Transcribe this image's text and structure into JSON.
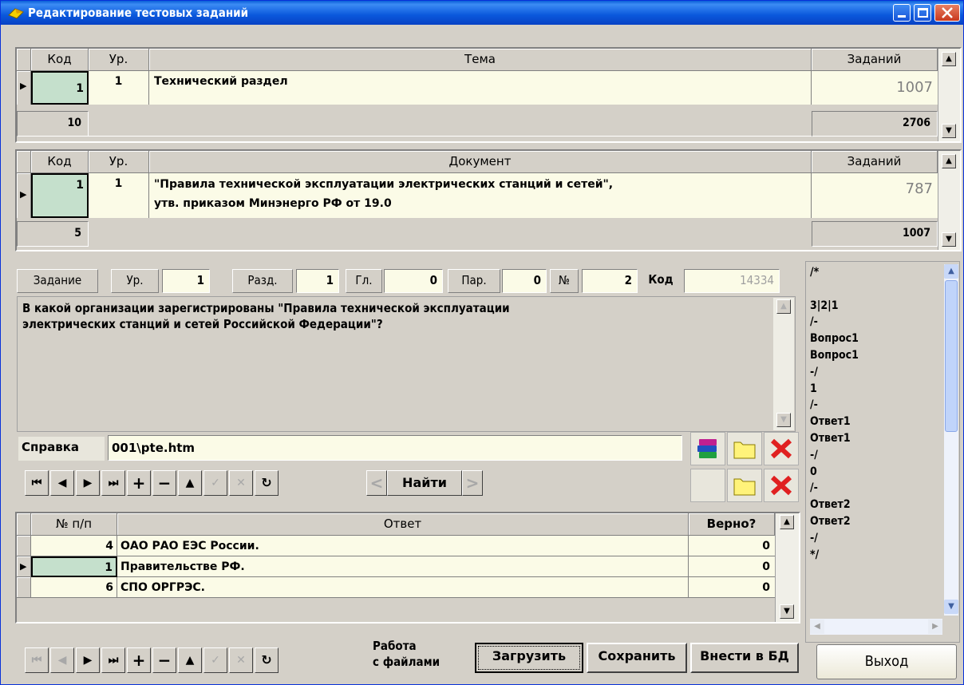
{
  "window": {
    "title": "Редактирование тестовых заданий"
  },
  "topics": {
    "headers": [
      "Код",
      "Ур.",
      "Тема",
      "Заданий"
    ],
    "row": {
      "code": "1",
      "level": "1",
      "topic": "Технический раздел",
      "count": "1007"
    },
    "footer": {
      "count": "10",
      "total": "2706"
    }
  },
  "documents": {
    "headers": [
      "Код",
      "Ур.",
      "Документ",
      "Заданий"
    ],
    "row": {
      "code": "1",
      "level": "1",
      "doc_line1": "\"Правила технической эксплуатации электрических станций и сетей\",",
      "doc_line2": "утв. приказом Минэнерго РФ от 19.0",
      "count": "787"
    },
    "footer": {
      "count": "5",
      "total": "1007"
    }
  },
  "task": {
    "label": "Задание",
    "level_label": "Ур.",
    "level": "1",
    "section_label": "Разд.",
    "section": "1",
    "chapter_label": "Гл.",
    "chapter": "0",
    "paragraph_label": "Пар.",
    "paragraph": "0",
    "number_label": "№",
    "number": "2",
    "code_label": "Код",
    "code": "14334",
    "question_line1": "В какой организации зарегистрированы \"Правила технической эксплуатации",
    "question_line2": "электрических станций и сетей Российской Федерации\"?",
    "help_label": "Справка",
    "help_value": "001\\pte.htm",
    "find_label": "Найти"
  },
  "answers": {
    "headers": [
      "№ п/п",
      "Ответ",
      "Верно?"
    ],
    "rows": [
      {
        "num": "4",
        "text": "ОАО РАО ЕЭС России.",
        "correct": "0"
      },
      {
        "num": "1",
        "text": "Правительстве РФ.",
        "correct": "0"
      },
      {
        "num": "6",
        "text": "СПО ОРГРЭС.",
        "correct": "0"
      }
    ]
  },
  "file_panel": {
    "lines": [
      "/*",
      "",
      "3|2|1",
      "/-",
      "Вопрос1",
      "Вопрос1",
      "-/",
      "1",
      "/-",
      "Ответ1",
      "Ответ1",
      "-/",
      "0",
      "/-",
      "Ответ2",
      "Ответ2",
      "-/",
      "*/"
    ]
  },
  "bottom": {
    "files_label_1": "Работа",
    "files_label_2": "с файлами",
    "load": "Загрузить",
    "save": "Сохранить",
    "db": "Внести в БД",
    "exit": "Выход"
  },
  "nav_symbols": {
    "first": "⏮",
    "prev": "◀",
    "next": "▶",
    "last": "⏭",
    "add": "+",
    "del": "−",
    "up": "▲",
    "ok": "✓",
    "cancel": "✕",
    "refresh": "↻",
    "lt": "<",
    "gt": ">"
  },
  "colors": {
    "title": "#0a5fd8",
    "selected": "#c5e0cc",
    "row": "#fbfbe7",
    "delete": "#e02020"
  }
}
